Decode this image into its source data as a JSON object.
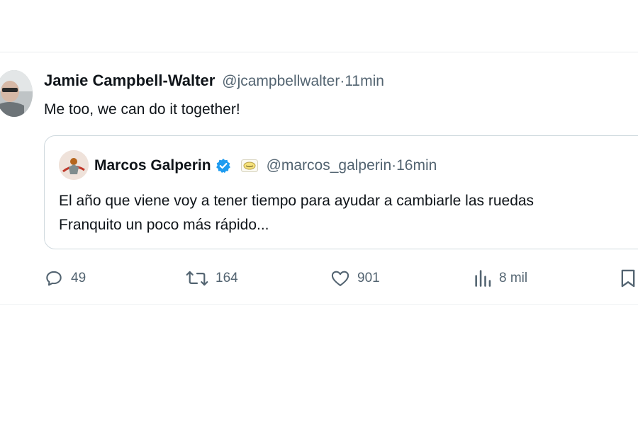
{
  "tweet": {
    "author_name": "Jamie Campbell-Walter",
    "author_handle": "@jcampbellwalter",
    "time": "11min",
    "text": "Me too, we can do it together!"
  },
  "quoted_tweet": {
    "author_name": "Marcos Galperin",
    "verified": true,
    "author_handle": "@marcos_galperin",
    "time": "16min",
    "text_lines": [
      "El año que viene voy a tener tiempo para ayudar a cambiarle las ruedas",
      "Franquito un poco más rápido..."
    ]
  },
  "actions": {
    "replies": "49",
    "reposts": "164",
    "likes": "901",
    "views": "8 mil"
  },
  "separator": " · ",
  "colors": {
    "text": "#0f1419",
    "secondary": "#536471",
    "verified": "#1d9bf0",
    "border": "#cfd9de"
  },
  "icons": [
    "comment-icon",
    "repost-icon",
    "heart-icon",
    "views-icon",
    "bookmark-icon",
    "verified-badge-icon",
    "affiliate-badge-icon"
  ]
}
